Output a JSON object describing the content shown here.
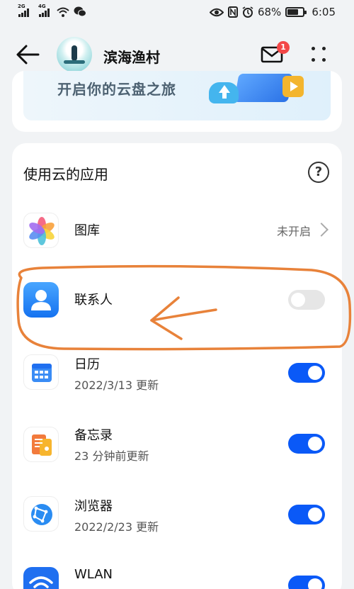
{
  "status_bar": {
    "net1": "2G",
    "net2": "4G",
    "battery": "68%",
    "time": "6:05"
  },
  "header": {
    "title": "滨海渔村",
    "notification_count": "1"
  },
  "promo": {
    "text": "开启你的云盘之旅"
  },
  "cloud_apps": {
    "title": "使用云的应用",
    "help": "?",
    "items": [
      {
        "name": "图库",
        "status": "未开启",
        "control": "chevron"
      },
      {
        "name": "联系人",
        "toggle": "off"
      },
      {
        "name": "日历",
        "subtitle": "2022/3/13 更新",
        "toggle": "on"
      },
      {
        "name": "备忘录",
        "subtitle": "23 分钟前更新",
        "toggle": "on"
      },
      {
        "name": "浏览器",
        "subtitle": "2022/2/23 更新",
        "toggle": "on"
      },
      {
        "name": "WLAN",
        "toggle": "on"
      }
    ]
  },
  "colors": {
    "accent": "#0a59f7",
    "badge": "#f34747",
    "annotation": "#e8823a"
  }
}
